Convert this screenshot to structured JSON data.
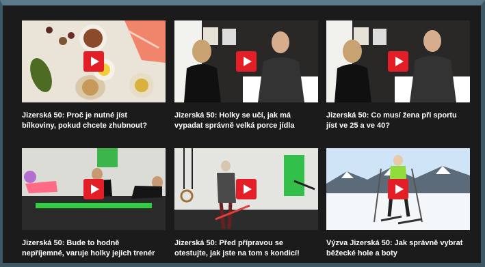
{
  "videos": [
    {
      "line1": "Jizerská 50: Proč je nutné jíst",
      "line2": "bílkoviny, pokud chcete zhubnout?",
      "play": "play-icon"
    },
    {
      "line1": "Jizerská 50: Holky se učí, jak má",
      "line2": "vypadat správně velká porce jídla",
      "play": "play-icon"
    },
    {
      "line1": "Jizerská 50: Co musí žena při sportu",
      "line2": "jíst ve 25 a ve 40?",
      "play": "play-icon"
    },
    {
      "line1": "Jizerská 50: Bude to hodně",
      "line2": "nepříjemné, varuje holky jejich trenér",
      "play": "play-icon"
    },
    {
      "line1": "Jizerská 50: Před přípravou se",
      "line2": "otestujte, jak jste na tom s kondicí!",
      "play": "play-icon"
    },
    {
      "line1": "Výzva Jizerská 50: Jak správně vybrat",
      "line2": "běžecké hole a boty",
      "play": "play-icon"
    }
  ],
  "colors": {
    "background": "#1b1b1b",
    "play_button": "#e41e26",
    "frame": "#5a7a8c"
  }
}
